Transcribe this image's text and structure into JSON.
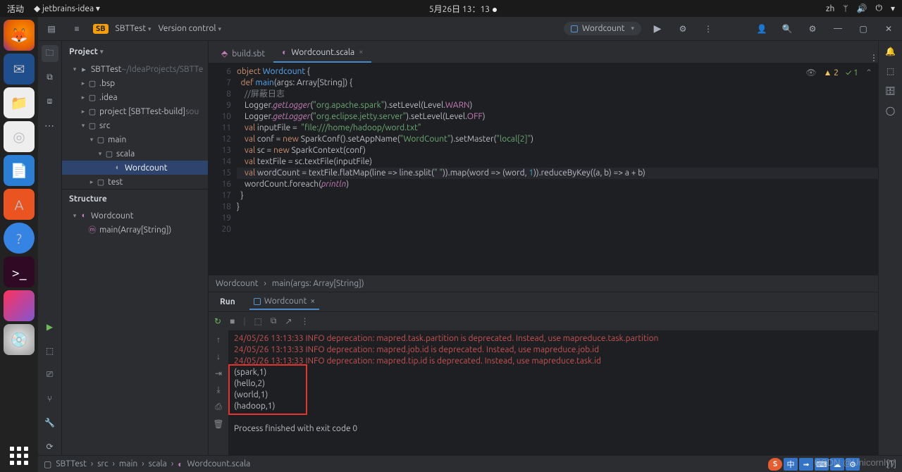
{
  "sysbar": {
    "activities": "活动",
    "app": "jetbrains-idea",
    "clock": "5月26日 13：13",
    "lang": "zh"
  },
  "titlebar": {
    "project": "SBTTest",
    "vcs": "Version control",
    "runcfg": "Wordcount"
  },
  "project_panel": {
    "title": "Project",
    "root": "SBTTest",
    "root_path": "~/IdeaProjects/SBTTest",
    "nodes": [
      {
        "indent": 1,
        "chev": "▾",
        "icon": "▸",
        "label": "SBTTest",
        "suffix": " ~/IdeaProjects/SBTTe"
      },
      {
        "indent": 2,
        "chev": "▸",
        "icon": "▢",
        "label": ".bsp"
      },
      {
        "indent": 2,
        "chev": "▸",
        "icon": "▢",
        "label": ".idea"
      },
      {
        "indent": 2,
        "chev": "▸",
        "icon": "▢",
        "label": "project [SBTTest-build]",
        "suffix": " sou"
      },
      {
        "indent": 2,
        "chev": "▾",
        "icon": "▢",
        "label": "src"
      },
      {
        "indent": 3,
        "chev": "▾",
        "icon": "▢",
        "label": "main"
      },
      {
        "indent": 4,
        "chev": "▾",
        "icon": "▢",
        "label": "scala",
        "cls": "pkg"
      },
      {
        "indent": 5,
        "chev": "",
        "icon": "◐",
        "label": "Wordcount",
        "sel": true
      },
      {
        "indent": 3,
        "chev": "▸",
        "icon": "▢",
        "label": "test"
      }
    ],
    "structure_title": "Structure",
    "structure": [
      {
        "indent": 1,
        "chev": "▾",
        "icon": "◐",
        "label": "Wordcount"
      },
      {
        "indent": 2,
        "chev": "",
        "icon": "ⓜ",
        "label": "main(Array[String])"
      }
    ]
  },
  "tabs": [
    {
      "icon": "⬘",
      "label": "build.sbt",
      "active": false,
      "closable": false
    },
    {
      "icon": "◐",
      "label": "Wordcount.scala",
      "active": true,
      "closable": true
    }
  ],
  "editor": {
    "first_line": 6,
    "warn_count": "2",
    "ok_count": "1",
    "lines": [
      {
        "n": 6,
        "html": "<span class='kw'>object</span> <span class='fn'>Wordcount</span> {"
      },
      {
        "n": 7,
        "html": "  <span class='kw'>def</span> <span class='fn'>main</span>(<span class='ident'>args</span>: <span class='tp'>Array</span>[<span class='tp'>String</span>]) {"
      },
      {
        "n": 8,
        "html": "    <span class='cmt'>//屏蔽日志</span>"
      },
      {
        "n": 9,
        "html": "    <span class='ident'>Logger</span>.<span class='def'>getLogger</span>(<span class='str'>\"org.apache.spark\"</span>).<span class='ident'>setLevel</span>(<span class='ident'>Level</span>.<span class='fld'>WARN</span>)"
      },
      {
        "n": 10,
        "html": "    <span class='ident'>Logger</span>.<span class='def'>getLogger</span>(<span class='str'>\"org.eclipse.jetty.server\"</span>).<span class='ident'>setLevel</span>(<span class='ident'>Level</span>.<span class='fld'>OFF</span>)"
      },
      {
        "n": 11,
        "html": "    <span class='kw'>val</span> <span class='ident'>inputFile</span> =  <span class='str'>\"file:///home/hadoop/word.txt\"</span>"
      },
      {
        "n": 12,
        "html": "    <span class='kw'>val</span> <span class='ident'>conf</span> = <span class='kw'>new</span> <span class='ident'>SparkConf</span>().<span class='ident'>setAppName</span>(<span class='str'>\"WordCount\"</span>).<span class='ident'>setMaster</span>(<span class='str'>\"local[2]\"</span>)"
      },
      {
        "n": 13,
        "html": "    <span class='kw'>val</span> <span class='ident'>sc</span> = <span class='kw'>new</span> <span class='ident'>SparkContext</span>(<span class='ident'>conf</span>)"
      },
      {
        "n": 14,
        "html": "    <span class='kw'>val</span> <span class='ident'>textFile</span> = <span class='ident'>sc</span>.<span class='ident'>textFile</span>(<span class='ident'>inputFile</span>)"
      },
      {
        "n": 15,
        "html": "    <span class='kw'>val</span> <span class='ident'>wordCount</span> = <span class='ident'>textFile</span>.<span class='ident'>flatMap</span>(<span class='ident'>line</span> =&gt; <span class='ident'>line</span>.<span class='ident'>split</span>(<span class='str'>\" \"</span>)).<span class='ident'>map</span>(<span class='ident'>word</span> =&gt; (<span class='ident'>word</span>, <span class='num'>1</span>)).<span class='ident'>reduceByKey</span>((<span class='ident'>a</span>, <span class='ident'>b</span>) =&gt; <span class='ident'>a</span> + <span class='ident'>b</span>)",
        "caret": true
      },
      {
        "n": 16,
        "html": "    <span class='ident'>wordCount</span>.<span class='ident'>foreach</span>(<span class='def'>println</span>)"
      },
      {
        "n": 17,
        "html": "  }"
      },
      {
        "n": 18,
        "html": "}"
      },
      {
        "n": 19,
        "html": ""
      },
      {
        "n": 20,
        "html": ""
      }
    ]
  },
  "crumbs": [
    "Wordcount",
    "main(args: Array[String])"
  ],
  "run": {
    "title": "Run",
    "tab": "Wordcount",
    "lines": [
      {
        "cls": "log",
        "text": "24/05/26 13:13:33 INFO deprecation: mapred.task.partition is deprecated. Instead, use mapreduce.task.partition"
      },
      {
        "cls": "log",
        "text": "24/05/26 13:13:33 INFO deprecation: mapred.job.id is deprecated. Instead, use mapreduce.job.id"
      },
      {
        "cls": "log",
        "text": "24/05/26 13:13:33 INFO deprecation: mapred.tip.id is deprecated. Instead, use mapreduce.task.id"
      },
      {
        "cls": "out",
        "text": "(spark,1)"
      },
      {
        "cls": "out",
        "text": "(hello,2)"
      },
      {
        "cls": "out",
        "text": "(world,1)"
      },
      {
        "cls": "out",
        "text": "(hadoop,1)"
      },
      {
        "cls": "out",
        "text": ""
      },
      {
        "cls": "out",
        "text": "Process finished with exit code 0"
      }
    ]
  },
  "status": {
    "crumbs": [
      "SBTTest",
      "src",
      "main",
      "scala",
      "Wordcount.scala"
    ],
    "right": "[T]"
  },
  "watermark": "CSDN @Unicornlyy",
  "ime": [
    "中",
    "➟",
    "⌨",
    "☁",
    "⚙"
  ]
}
